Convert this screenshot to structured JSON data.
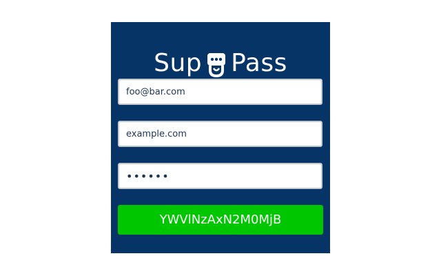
{
  "brand": {
    "word_left": "Sup",
    "word_right": "Pass",
    "icon": "mascot-face-icon",
    "color_text": "#ffffff",
    "color_panel": "#063466"
  },
  "form": {
    "email": {
      "value": "foo@bar.com",
      "placeholder": ""
    },
    "site": {
      "value": "example.com",
      "placeholder": ""
    },
    "master_password": {
      "value": "supsup",
      "placeholder": ""
    }
  },
  "result": {
    "generated_password": "YWVlNzAxN2M0MjB",
    "color": "#00c600"
  }
}
